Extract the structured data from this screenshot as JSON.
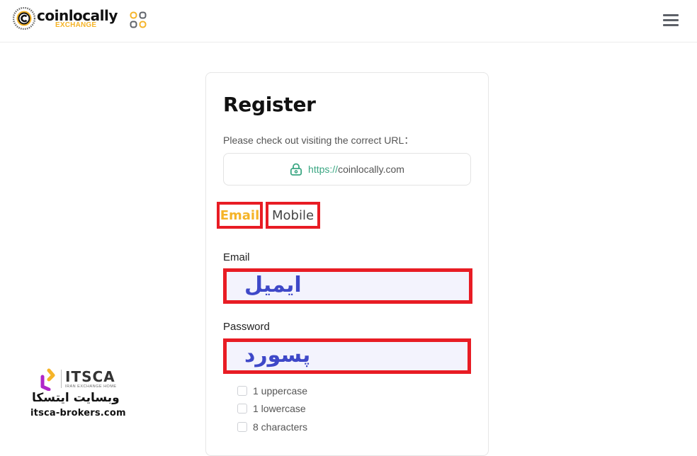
{
  "header": {
    "logo_word": "coinlocally",
    "logo_sub": "EXCHANGE",
    "apps_icon": "grid-dots-icon",
    "menu_icon": "hamburger-menu-icon",
    "colors": {
      "brand_yellow": "#f5b428",
      "icon_gray": "#5d6168"
    }
  },
  "register": {
    "title": "Register",
    "hint": "Please check out visiting the correct URL：",
    "url": {
      "protocol": "https://",
      "host": "coinlocally.com",
      "icon": "lock-icon",
      "color": "#3aa682"
    },
    "tabs": [
      {
        "label": "Email",
        "active": true
      },
      {
        "label": "Mobile",
        "active": false
      }
    ],
    "email": {
      "label": "Email",
      "value": "ایمیل"
    },
    "password": {
      "label": "Password",
      "value": "پسورد"
    },
    "requirements": [
      {
        "label": "1 uppercase",
        "checked": false
      },
      {
        "label": "1 lowercase",
        "checked": false
      },
      {
        "label": "8 characters",
        "checked": false
      }
    ],
    "highlight_color": "#e81c24"
  },
  "watermark": {
    "name": "ITSCA",
    "tagline": "IRAN EXCHANGE HOME",
    "persian": "وبسایت ایتسکا",
    "url": "itsca-brokers.com"
  }
}
